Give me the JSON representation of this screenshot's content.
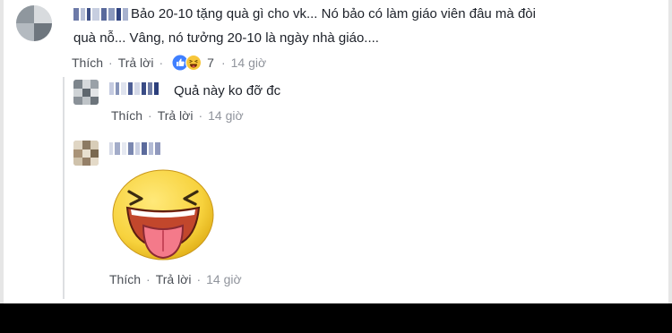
{
  "comments": [
    {
      "text_line1": "Bảo 20-10 tặng quà gì cho vk... Nó bảo có làm giáo viên đâu mà đòi",
      "text_line2": "quà nỗ... Vâng, nó tưởng 20-10 là ngày nhà giáo....",
      "actions": {
        "like": "Thích",
        "reply": "Trả lời",
        "time": "14 giờ"
      },
      "reactions": {
        "count": "7",
        "icons": [
          "like-icon",
          "haha-icon"
        ]
      }
    },
    {
      "text": "Quả này ko đỡ đc",
      "actions": {
        "like": "Thích",
        "reply": "Trả lời",
        "time": "14 giờ"
      }
    },
    {
      "sticker": "tongue-out-emoji-sticker",
      "actions": {
        "like": "Thích",
        "reply": "Trả lời",
        "time": "14 giờ"
      }
    }
  ],
  "separator": "·",
  "colors": {
    "sticker_yellow": "#f7d23d",
    "facebook_blue": "#3b5998",
    "link_gray": "#4b4f56"
  }
}
